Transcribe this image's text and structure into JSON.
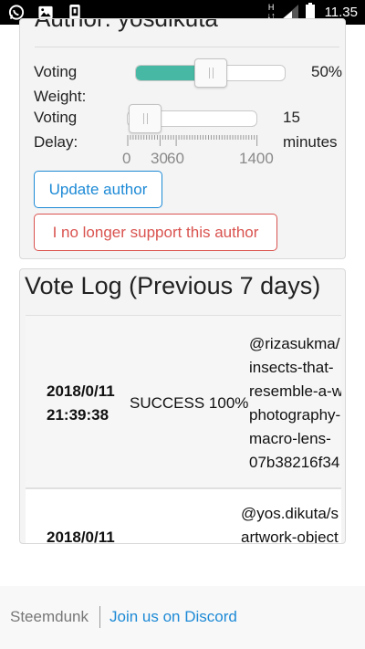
{
  "statusbar": {
    "time": "11.35",
    "network_label": "H"
  },
  "author": {
    "title": "Author: yosdikuta",
    "voting_weight_label_1": "Voting",
    "voting_weight_label_2": "Weight:",
    "voting_weight_value": "50%",
    "voting_weight_level": 0.5,
    "voting_delay_label_1": "Voting",
    "voting_delay_label_2": "Delay:",
    "voting_delay_value": "15",
    "voting_delay_unit": "minutes",
    "voting_delay_level": 0.0107,
    "delay_ticks": [
      "0",
      "30",
      "60",
      "1400"
    ],
    "update_button": "Update author",
    "unsupport_button": "I no longer support this author"
  },
  "vote_log": {
    "title": "Vote Log (Previous 7 days)",
    "rows": [
      {
        "date_line1": "2018/0/11",
        "date_line2": "21:39:38",
        "status": "SUCCESS 100%",
        "link_lines": [
          "@rizasukma/",
          "insects-that-",
          "resemble-a-w",
          "photography-",
          "macro-lens-",
          "07b38216f34"
        ]
      },
      {
        "date_line1": "2018/0/11",
        "date_line2": "",
        "status": "",
        "link_lines": [
          "@yos.dikuta/s",
          "artwork-object"
        ]
      }
    ]
  },
  "footer": {
    "brand": "Steemdunk",
    "discord_link": "Join us on Discord"
  },
  "colors": {
    "accent": "#1d8ad6",
    "danger": "#d9534f",
    "slider_fill": "#46b8a3"
  }
}
